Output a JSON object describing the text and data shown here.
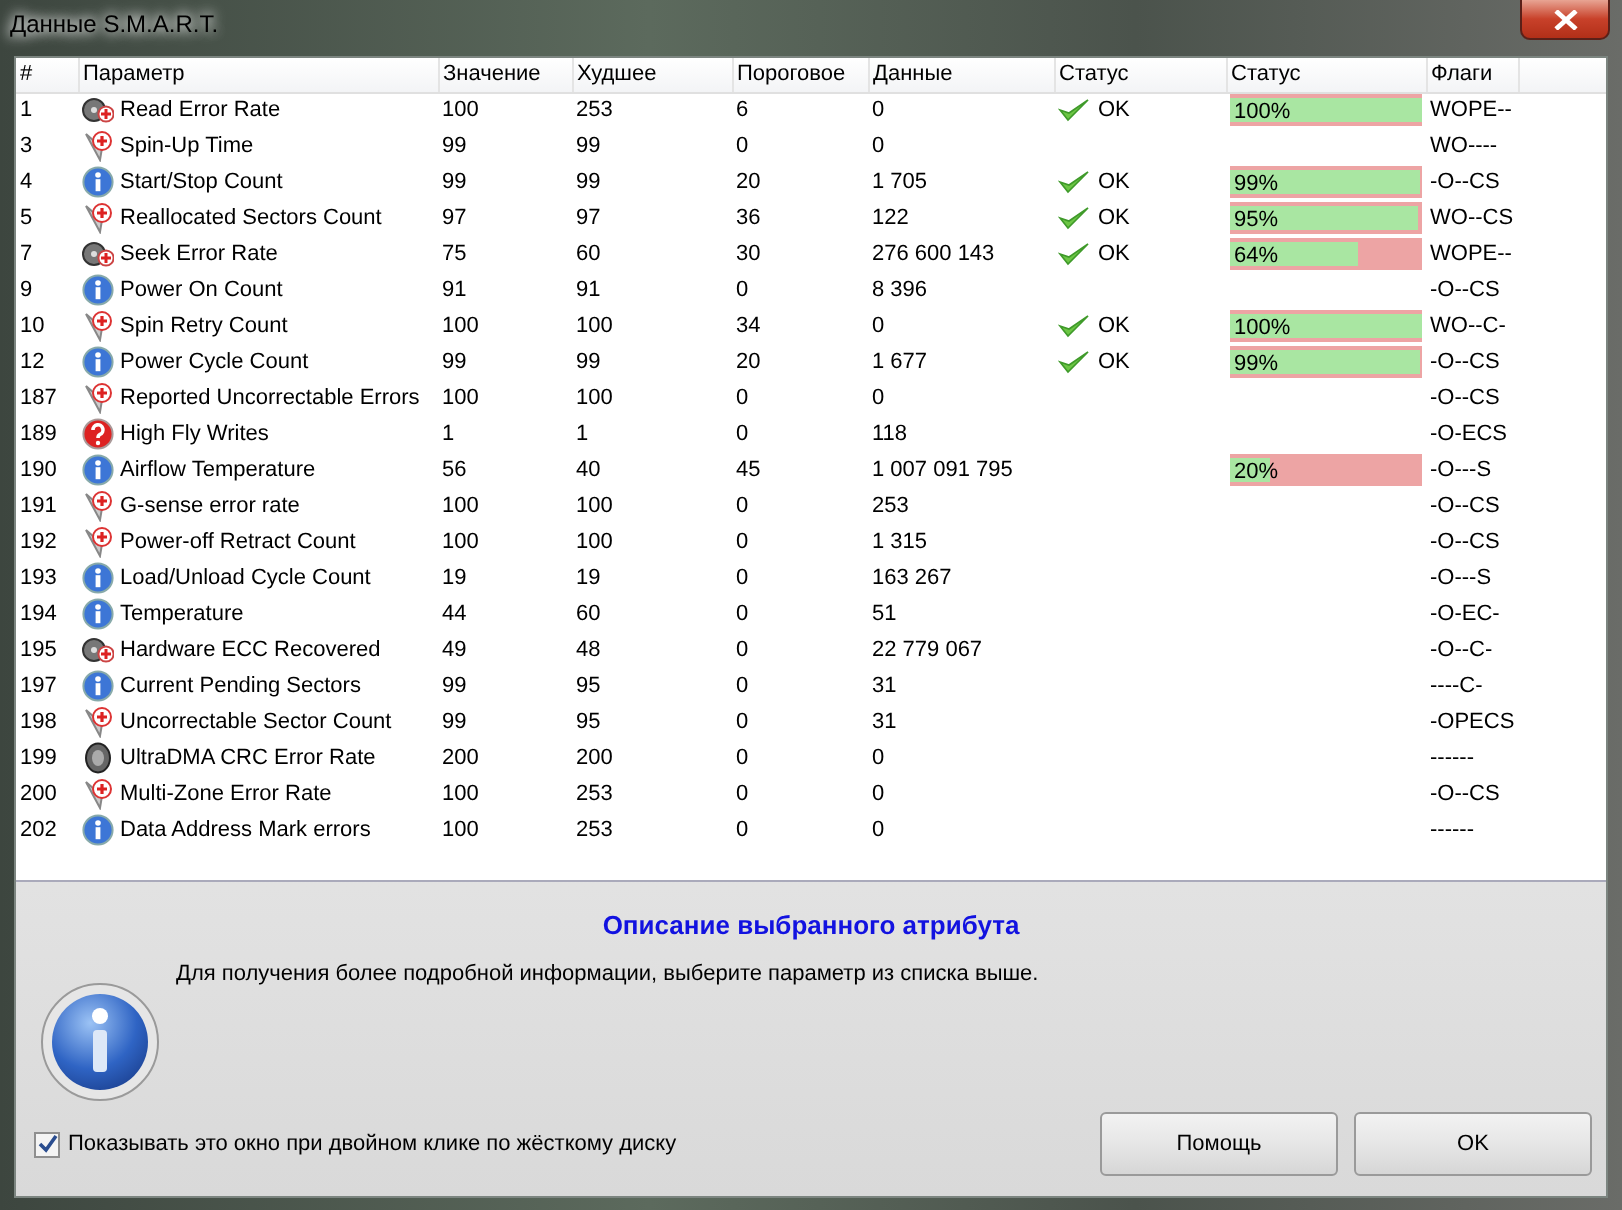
{
  "window": {
    "title": "Данные S.M.A.R.T."
  },
  "table": {
    "columns": [
      "#",
      "Параметр",
      "Значение",
      "Худшее",
      "Пороговое",
      "Данные",
      "Статус",
      "Статус",
      "Флаги"
    ],
    "rows": [
      {
        "id": "1",
        "kind": "disk",
        "name": "Read Error Rate",
        "value": "100",
        "worst": "253",
        "threshold": "6",
        "data": "0",
        "status": "OK",
        "health": {
          "label": "100%",
          "level": 1.0
        },
        "flags": "WOPE--"
      },
      {
        "id": "3",
        "kind": "pin",
        "name": "Spin-Up Time",
        "value": "99",
        "worst": "99",
        "threshold": "0",
        "data": "0",
        "flags": "WO----"
      },
      {
        "id": "4",
        "kind": "info",
        "name": "Start/Stop Count",
        "value": "99",
        "worst": "99",
        "threshold": "20",
        "data": "1 705",
        "status": "OK",
        "health": {
          "label": "99%",
          "level": 0.99
        },
        "flags": "-O--CS"
      },
      {
        "id": "5",
        "kind": "pin",
        "name": "Reallocated Sectors Count",
        "value": "97",
        "worst": "97",
        "threshold": "36",
        "data": "122",
        "status": "OK",
        "health": {
          "label": "95%",
          "level": 0.98
        },
        "flags": "WO--CS"
      },
      {
        "id": "7",
        "kind": "disk",
        "name": "Seek Error Rate",
        "value": "75",
        "worst": "60",
        "threshold": "30",
        "data": "276 600 143",
        "status": "OK",
        "health": {
          "label": "64%",
          "level": 0.67
        },
        "flags": "WOPE--"
      },
      {
        "id": "9",
        "kind": "info",
        "name": "Power On Count",
        "value": "91",
        "worst": "91",
        "threshold": "0",
        "data": "8 396",
        "flags": "-O--CS"
      },
      {
        "id": "10",
        "kind": "pin",
        "name": "Spin Retry Count",
        "value": "100",
        "worst": "100",
        "threshold": "34",
        "data": "0",
        "status": "OK",
        "health": {
          "label": "100%",
          "level": 1.0
        },
        "flags": "WO--C-"
      },
      {
        "id": "12",
        "kind": "info",
        "name": "Power Cycle Count",
        "value": "99",
        "worst": "99",
        "threshold": "20",
        "data": "1 677",
        "status": "OK",
        "health": {
          "label": "99%",
          "level": 0.99
        },
        "flags": "-O--CS"
      },
      {
        "id": "187",
        "kind": "pin",
        "name": "Reported Uncorrectable Errors",
        "value": "100",
        "worst": "100",
        "threshold": "0",
        "data": "0",
        "flags": "-O--CS"
      },
      {
        "id": "189",
        "kind": "question",
        "name": "High Fly Writes",
        "value": "1",
        "worst": "1",
        "threshold": "0",
        "data": "118",
        "flags": "-O-ECS"
      },
      {
        "id": "190",
        "kind": "info",
        "name": "Airflow Temperature",
        "value": "56",
        "worst": "40",
        "threshold": "45",
        "data": "1 007 091 795",
        "health": {
          "label": "20%",
          "level": 0.21
        },
        "flags": "-O---S"
      },
      {
        "id": "191",
        "kind": "pin",
        "name": "G-sense error rate",
        "value": "100",
        "worst": "100",
        "threshold": "0",
        "data": "253",
        "flags": "-O--CS"
      },
      {
        "id": "192",
        "kind": "pin",
        "name": "Power-off Retract Count",
        "value": "100",
        "worst": "100",
        "threshold": "0",
        "data": "1 315",
        "flags": "-O--CS"
      },
      {
        "id": "193",
        "kind": "info",
        "name": "Load/Unload Cycle Count",
        "value": "19",
        "worst": "19",
        "threshold": "0",
        "data": "163 267",
        "flags": "-O---S"
      },
      {
        "id": "194",
        "kind": "info",
        "name": "Temperature",
        "value": "44",
        "worst": "60",
        "threshold": "0",
        "data": "51",
        "flags": "-O-EC-"
      },
      {
        "id": "195",
        "kind": "disk",
        "name": "Hardware ECC Recovered",
        "value": "49",
        "worst": "48",
        "threshold": "0",
        "data": "22 779 067",
        "flags": "-O--C-"
      },
      {
        "id": "197",
        "kind": "info",
        "name": "Current Pending Sectors",
        "value": "99",
        "worst": "95",
        "threshold": "0",
        "data": "31",
        "flags": "----C-"
      },
      {
        "id": "198",
        "kind": "pin",
        "name": "Uncorrectable Sector Count",
        "value": "99",
        "worst": "95",
        "threshold": "0",
        "data": "31",
        "flags": "-OPECS"
      },
      {
        "id": "199",
        "kind": "drive",
        "name": "UltraDMA CRC Error Rate",
        "value": "200",
        "worst": "200",
        "threshold": "0",
        "data": "0",
        "flags": "------"
      },
      {
        "id": "200",
        "kind": "pin",
        "name": "Multi-Zone Error Rate",
        "value": "100",
        "worst": "253",
        "threshold": "0",
        "data": "0",
        "flags": "-O--CS"
      },
      {
        "id": "202",
        "kind": "info",
        "name": "Data Address Mark errors",
        "value": "100",
        "worst": "253",
        "threshold": "0",
        "data": "0",
        "flags": "------"
      }
    ]
  },
  "description": {
    "title": "Описание выбранного атрибута",
    "text": "Для получения более подробной информации, выберите параметр из списка выше."
  },
  "show_on_double_click": {
    "label": "Показывать это окно при двойном клике по жёсткому диску",
    "checked": true
  },
  "buttons": [
    "Помощь",
    "OK"
  ]
}
